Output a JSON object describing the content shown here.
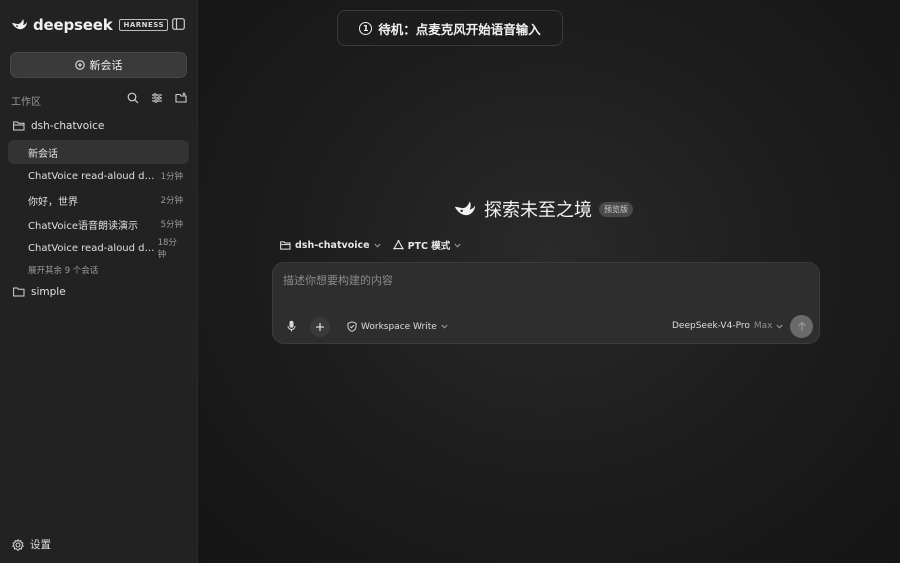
{
  "brand": {
    "name": "deepseek",
    "badge": "HARNESS"
  },
  "sidebar": {
    "new_chat_label": "新会话",
    "workspace_label": "工作区",
    "folders": [
      {
        "name": "dsh-chatvoice"
      },
      {
        "name": "simple"
      }
    ],
    "sessions": [
      {
        "title": "新会话",
        "time": ""
      },
      {
        "title": "ChatVoice read-aloud demo...",
        "time": "1分钟"
      },
      {
        "title": "你好，世界",
        "time": "2分钟"
      },
      {
        "title": "ChatVoice语音朗读演示",
        "time": "5分钟"
      },
      {
        "title": "ChatVoice read-aloud dem...",
        "time": "18分钟"
      }
    ],
    "expand_more": "展开其余 9 个会话",
    "settings_label": "设置"
  },
  "toast": {
    "number": "1",
    "text": "待机：点麦克风开始语音输入"
  },
  "hero": {
    "title": "探索未至之境",
    "badge": "预览版"
  },
  "context": {
    "workspace": "dsh-chatvoice",
    "mode": "PTC 模式"
  },
  "composer": {
    "placeholder": "描述你想要构建的内容",
    "value": "",
    "write_mode": "Workspace Write",
    "model": "DeepSeek-V4-Pro",
    "model_tier": "Max"
  },
  "colors": {
    "background": "#1a1a1b",
    "sidebar": "#222223",
    "send_button": "#6a6a6d"
  }
}
